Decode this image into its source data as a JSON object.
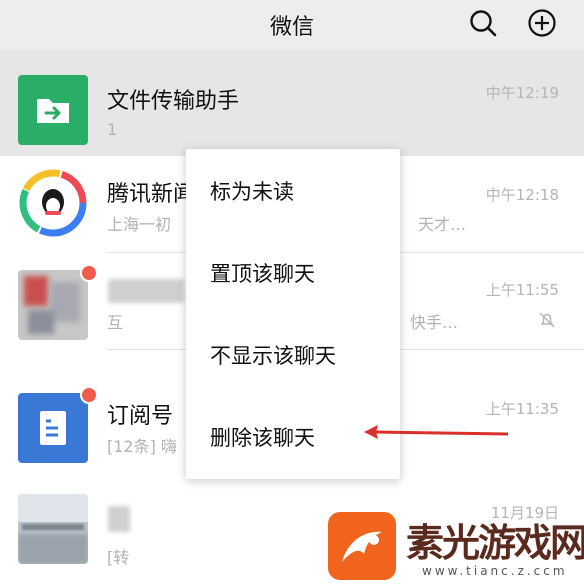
{
  "header": {
    "title": "微信",
    "search_icon": "search-icon",
    "add_icon": "add-circle-icon"
  },
  "chats": [
    {
      "name": "文件传输助手",
      "preview": "1",
      "time": "中午12:19",
      "avatar": "file-transfer-icon",
      "accent": "#2aae67"
    },
    {
      "name": "腾讯新闻",
      "preview": "上海一初",
      "preview_tail": "天才…",
      "time": "中午12:18",
      "avatar": "tencent-news-icon"
    },
    {
      "name": "",
      "preview": "互",
      "preview_tail": "快手…",
      "time": "上午11:55",
      "avatar": "blurred-avatar",
      "muted_icon": "mute-bell-icon"
    },
    {
      "name": "订阅号",
      "preview": "[12条] 嗨",
      "time": "上午11:35",
      "avatar": "subscription-icon",
      "accent": "#3a78d6"
    },
    {
      "name": "",
      "preview": "[转",
      "time": "11月19日",
      "avatar": "blurred-photo-avatar"
    }
  ],
  "context_menu": {
    "items": [
      "标为未读",
      "置顶该聊天",
      "不显示该聊天",
      "删除该聊天"
    ]
  },
  "watermark": {
    "text": "素光游戏网",
    "url_text": "www.tianc.z.ccm"
  },
  "colors": {
    "header_bg": "#ededed",
    "badge_red": "#f05b4e",
    "arrow_red": "#d9302a"
  }
}
